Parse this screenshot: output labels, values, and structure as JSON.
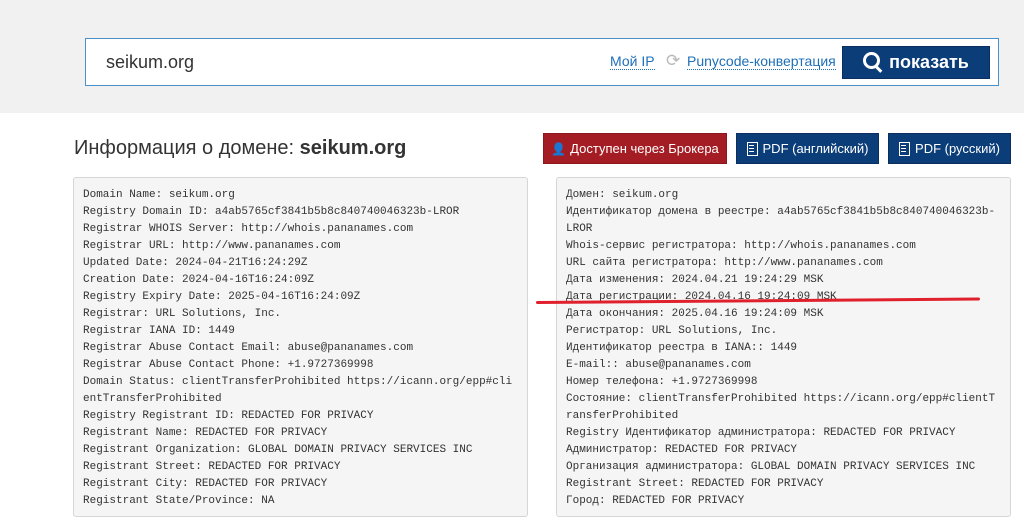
{
  "search": {
    "value": "seikum.org",
    "my_ip": "Мой IP",
    "punycode": "Punycode-конвертация",
    "show": "показать"
  },
  "title": {
    "prefix": "Информация о домене: ",
    "domain": "seikum.org"
  },
  "buttons": {
    "broker": "Доступен через Брокера",
    "pdf_en": "PDF (английский)",
    "pdf_ru": "PDF (русский)"
  },
  "whois_en": [
    "Domain Name: seikum.org",
    "Registry Domain ID: a4ab5765cf3841b5b8c840740046323b-LROR",
    "Registrar WHOIS Server: http://whois.pananames.com",
    "Registrar URL: http://www.pananames.com",
    "Updated Date: 2024-04-21T16:24:29Z",
    "Creation Date: 2024-04-16T16:24:09Z",
    "Registry Expiry Date: 2025-04-16T16:24:09Z",
    "Registrar: URL Solutions, Inc.",
    "Registrar IANA ID: 1449",
    "Registrar Abuse Contact Email: abuse@pananames.com",
    "Registrar Abuse Contact Phone: +1.9727369998",
    "Domain Status: clientTransferProhibited https://icann.org/epp#clientTransferProhibited",
    "Registry Registrant ID: REDACTED FOR PRIVACY",
    "Registrant Name: REDACTED FOR PRIVACY",
    "Registrant Organization: GLOBAL DOMAIN PRIVACY SERVICES INC",
    "Registrant Street: REDACTED FOR PRIVACY",
    "Registrant City: REDACTED FOR PRIVACY",
    "Registrant State/Province: NA"
  ],
  "whois_ru": [
    "Домен: seikum.org",
    "Идентификатор домена в реестре: a4ab5765cf3841b5b8c840740046323b-LROR",
    "Whois-сервис регистратора: http://whois.pananames.com",
    "URL сайта регистратора: http://www.pananames.com",
    "Дата изменения: 2024.04.21 19:24:29 MSK",
    "Дата регистрации: 2024.04.16 19:24:09 MSK",
    "Дата окончания: 2025.04.16 19:24:09 MSK",
    "Регистратор: URL Solutions, Inc.",
    "Идентификатор реестра в IANA:: 1449",
    "E-mail:: abuse@pananames.com",
    "Номер телефона: +1.9727369998",
    "Состояние: clientTransferProhibited https://icann.org/epp#clientTransferProhibited",
    "Registry Идентификатор администратора: REDACTED FOR PRIVACY",
    "Администратор: REDACTED FOR PRIVACY",
    "Организация администратора: GLOBAL DOMAIN PRIVACY SERVICES INC",
    "Registrant Street: REDACTED FOR PRIVACY",
    "Город: REDACTED FOR PRIVACY"
  ],
  "colors": {
    "primary": "#0b3d78",
    "danger": "#a51d24",
    "link": "#1e6fb8",
    "underline": "#e0202c"
  },
  "icons": {
    "refresh": "refresh-icon",
    "search": "search-icon",
    "user": "user-icon",
    "pdf": "pdf-icon"
  }
}
